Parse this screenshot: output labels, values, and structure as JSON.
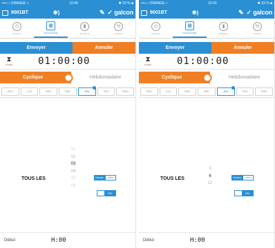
{
  "screens": [
    {
      "status": {
        "carrier": "•••○○ ORANGE ≈",
        "time": "10:40",
        "battery": "✱ 33 % ■"
      },
      "nav": {
        "device": "9001BT",
        "bt_icon": "bluetooth-sound-icon",
        "edit_icon": "pencil-icon",
        "logo": "✓ galcon"
      },
      "tabs": [
        {
          "label": "MANUEL",
          "icon": "clock-icon"
        },
        {
          "label": "PROGRAMME",
          "icon": "calendar-icon"
        },
        {
          "label": "SENSEUR",
          "icon": "pin-icon"
        },
        {
          "label": "AVANCÉ",
          "icon": "percent-icon"
        }
      ],
      "send": "Envoyer",
      "cancel": "Annuler",
      "duration_caption": "DURÉE",
      "duration": "01:00:00",
      "mode_cyclic": "Cyclique",
      "mode_weekly": "Hebdomadaire",
      "days": [
        "Dim",
        "Lun",
        "Mar",
        "Mer",
        "Jeu",
        "Ven",
        "Sam"
      ],
      "every_label": "TOUS LES",
      "wheel": [
        "01",
        "02",
        "03",
        "04",
        "05",
        "06"
      ],
      "wheel_selected": "03",
      "units": [
        "Heures",
        "Jours"
      ],
      "switch_label": "ON",
      "start_label": "Début",
      "start_value": "H:00"
    },
    {
      "status": {
        "carrier": "•••○○ ORANGE ≈",
        "time": "10:41",
        "battery": "✱ 33 % ■"
      },
      "nav": {
        "device": "9001BT",
        "bt_icon": "bluetooth-sound-icon",
        "edit_icon": "pencil-icon",
        "logo": "✓ galcon"
      },
      "tabs": [
        {
          "label": "MANUEL",
          "icon": "clock-icon"
        },
        {
          "label": "PROGRAMME",
          "icon": "calendar-icon"
        },
        {
          "label": "SENSEUR",
          "icon": "pin-icon"
        },
        {
          "label": "AVANCÉ",
          "icon": "percent-icon"
        }
      ],
      "send": "Envoyer",
      "cancel": "Annuler",
      "duration_caption": "DURÉE",
      "duration": "01:00:00",
      "mode_cyclic": "Cyclique",
      "mode_weekly": "Hebdomadaire",
      "days": [
        "Dim",
        "Lun",
        "Mar",
        "Mer",
        "Jeu",
        "Ven",
        "Sam"
      ],
      "every_label": "TOUS LES",
      "wheel": [
        "3",
        "6",
        "12"
      ],
      "wheel_selected": "6",
      "units": [
        "Heures",
        "Jours"
      ],
      "switch_label": "ON",
      "start_label": "Début",
      "start_value": "H:00"
    }
  ],
  "active_tab_index": 1,
  "active_day_index": 4,
  "colors": {
    "blue": "#2b8fd3",
    "orange": "#f07f24"
  }
}
